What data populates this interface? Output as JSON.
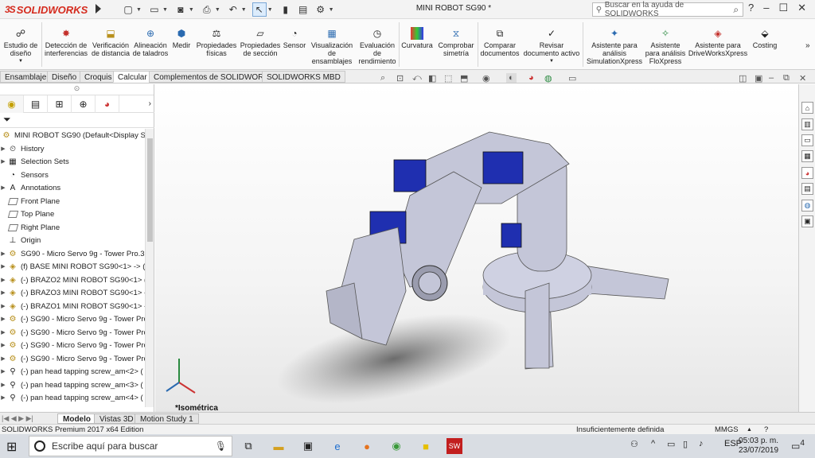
{
  "app": {
    "logo_text": "SOLIDWORKS",
    "logo_prefix": "3S",
    "document_title": "MINI ROBOT SG90 *",
    "help_placeholder": "Buscar en la ayuda de SOLIDWORKS",
    "help_mark": "?"
  },
  "ribbon": {
    "items": [
      {
        "label": "Estudio de diseño",
        "icon": "design-study-icon"
      },
      {
        "label": "Detección de interferencias",
        "icon": "interference-icon"
      },
      {
        "label": "Verificación de distancia",
        "icon": "clearance-icon"
      },
      {
        "label": "Alineación de taladros",
        "icon": "hole-alignment-icon"
      },
      {
        "label": "Medir",
        "icon": "measure-icon"
      },
      {
        "label": "Propiedades físicas",
        "icon": "mass-properties-icon"
      },
      {
        "label": "Propiedades de sección",
        "icon": "section-properties-icon"
      },
      {
        "label": "Sensor",
        "icon": "sensor-icon"
      },
      {
        "label": "Visualización de ensamblajes",
        "icon": "assembly-visualization-icon"
      },
      {
        "label": "Evaluación de rendimiento",
        "icon": "performance-icon"
      },
      {
        "label": "Curvatura",
        "icon": "curvature-icon"
      },
      {
        "label": "Comprobar simetría",
        "icon": "symmetry-icon"
      },
      {
        "label": "Comparar documentos",
        "icon": "compare-icon"
      },
      {
        "label": "Revisar documento activo",
        "icon": "check-active-icon"
      },
      {
        "label": "Asistente para análisis SimulationXpress",
        "icon": "simulationxpress-icon"
      },
      {
        "label": "Asistente para análisis FloXpress",
        "icon": "floxpress-icon"
      },
      {
        "label": "Asistente para DriveWorksXpress",
        "icon": "driveworksxpress-icon"
      },
      {
        "label": "Costing",
        "icon": "costing-icon"
      }
    ]
  },
  "tabs": [
    "Ensamblaje",
    "Diseño",
    "Croquis",
    "Calcular",
    "Complementos de SOLIDWORKS",
    "SOLIDWORKS MBD"
  ],
  "active_tab": "Calcular",
  "tree": {
    "root": "MINI ROBOT SG90  (Default<Display State",
    "items": [
      "History",
      "Selection Sets",
      "Sensors",
      "Annotations",
      "Front Plane",
      "Top Plane",
      "Right Plane",
      "Origin",
      "SG90 - Micro Servo 9g - Tower Pro.3<",
      "(f) BASE MINI ROBOT SG90<1> -> (D",
      "(-) BRAZO2 MINI ROBOT SG90<1> (D",
      "(-) BRAZO3 MINI ROBOT SG90<1> ->",
      "(-) BRAZO1 MINI ROBOT SG90<1> ->",
      "(-) SG90 - Micro Servo 9g - Tower Pro",
      "(-) SG90 - Micro Servo 9g - Tower Pro",
      "(-) SG90 - Micro Servo 9g - Tower Pro",
      "(-) SG90 - Micro Servo 9g - Tower Pro",
      "(-) pan head tapping screw_am<2> (",
      "(-) pan head tapping screw_am<3> (",
      "(-) pan head tapping screw_am<4> ("
    ]
  },
  "bottom_tabs": [
    "Modelo",
    "Vistas 3D",
    "Motion Study 1"
  ],
  "view_label": "*Isométrica",
  "status": {
    "left": "SOLIDWORKS Premium 2017 x64 Edition",
    "center": "Insuficientemente definida",
    "units": "MMGS"
  },
  "taskbar": {
    "search_placeholder": "Escribe aquí para buscar",
    "lang": "ESP",
    "time": "05:03 p. m.",
    "date": "23/07/2019",
    "notif": "4"
  },
  "colors": {
    "model": "#c4c6d8",
    "servo": "#1f2fb0",
    "brand": "#d52b1e"
  }
}
